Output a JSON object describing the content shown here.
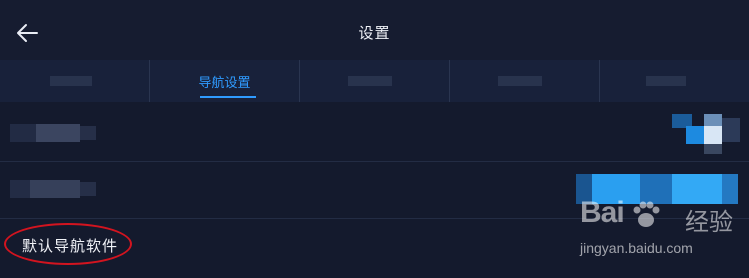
{
  "header": {
    "title": "设置",
    "back_icon": "arrow-left-icon"
  },
  "tabs": [
    {
      "label": ""
    },
    {
      "label": "导航设置",
      "active": true
    },
    {
      "label": ""
    },
    {
      "label": ""
    },
    {
      "label": ""
    }
  ],
  "rows": [
    {
      "label": "默认导航软件"
    }
  ],
  "watermark": {
    "brand": "Bai",
    "brand_suffix": "经验",
    "url": "jingyan.baidu.com"
  },
  "colors": {
    "background": "#141a2d",
    "accent": "#2f9bff",
    "annotation": "#d3141f"
  }
}
